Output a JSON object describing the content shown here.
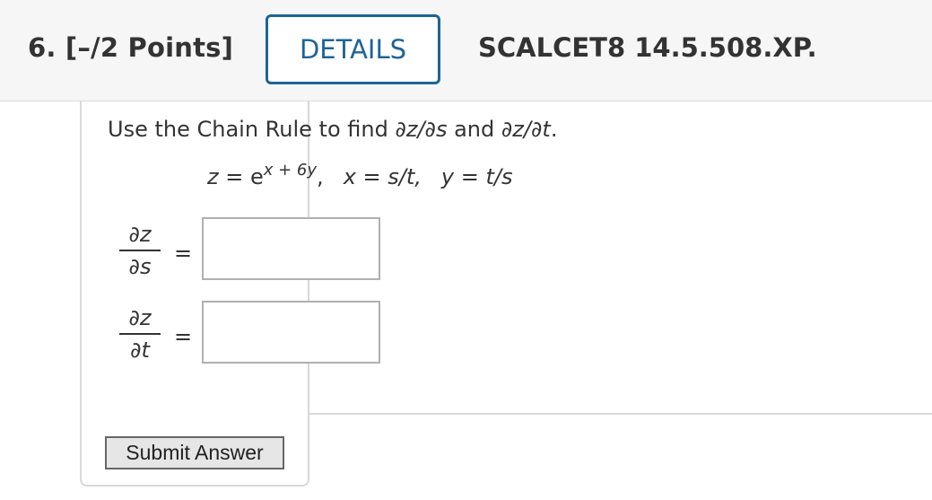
{
  "header": {
    "question_label": "6.  [–/2 Points]",
    "details_label": "DETAILS",
    "question_id": "SCALCET8 14.5.508.XP."
  },
  "question": {
    "prompt_prefix": "Use the Chain Rule to find ",
    "prompt_expr1": "∂z/∂s",
    "prompt_mid": " and ",
    "prompt_expr2": "∂z/∂t",
    "prompt_suffix": ".",
    "eq_z_lhs": "z",
    "eq_z_rel": " = e",
    "eq_z_exp": "x + 6y",
    "eq_z_tail": ",",
    "eq_x": "x = s/t,",
    "eq_y": "y = t/s"
  },
  "answers": [
    {
      "numerator": "∂z",
      "denominator": "∂s",
      "equals": "=",
      "value": ""
    },
    {
      "numerator": "∂z",
      "denominator": "∂t",
      "equals": "=",
      "value": ""
    }
  ],
  "submit_label": "Submit Answer",
  "colors": {
    "accent": "#1e6496",
    "header_bg": "#f6f6f6",
    "border": "#d8d8d8"
  }
}
